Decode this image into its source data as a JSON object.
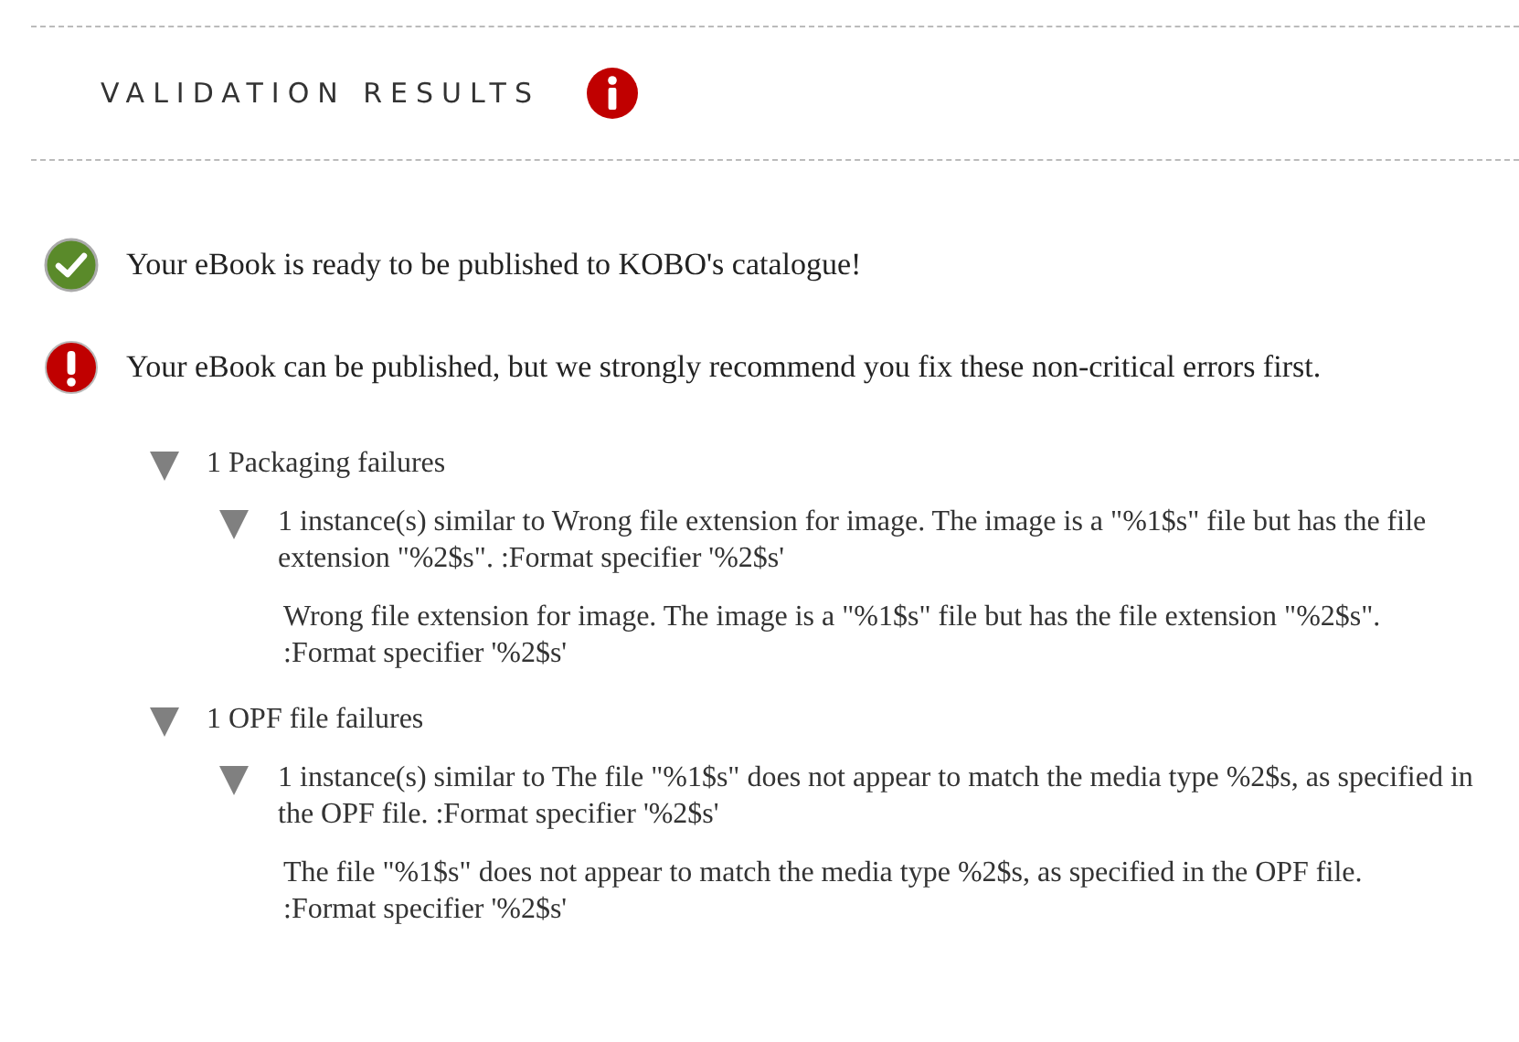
{
  "header": {
    "title": "VALIDATION RESULTS"
  },
  "messages": [
    {
      "kind": "success",
      "text": "Your eBook is ready to be published to KOBO's catalogue!"
    },
    {
      "kind": "warning",
      "text": "Your eBook can be published, but we strongly recommend you fix these non-critical errors first."
    }
  ],
  "failure_groups": [
    {
      "label": "1 Packaging failures",
      "expanded": true,
      "children": [
        {
          "label": "1 instance(s) similar to Wrong file extension for image. The image is a \"%1$s\" file but has the file extension \"%2$s\". :Format specifier '%2$s'",
          "expanded": true,
          "detail": "Wrong file extension for image. The image is a \"%1$s\" file but has the file extension \"%2$s\". :Format specifier '%2$s'"
        }
      ]
    },
    {
      "label": "1 OPF file failures",
      "expanded": true,
      "children": [
        {
          "label": "1 instance(s) similar to The file \"%1$s\" does not appear to match the media type %2$s, as specified in the OPF file. :Format specifier '%2$s'",
          "expanded": true,
          "detail": "The file \"%1$s\" does not appear to match the media type %2$s, as specified in the OPF file. :Format specifier '%2$s'"
        }
      ]
    }
  ]
}
